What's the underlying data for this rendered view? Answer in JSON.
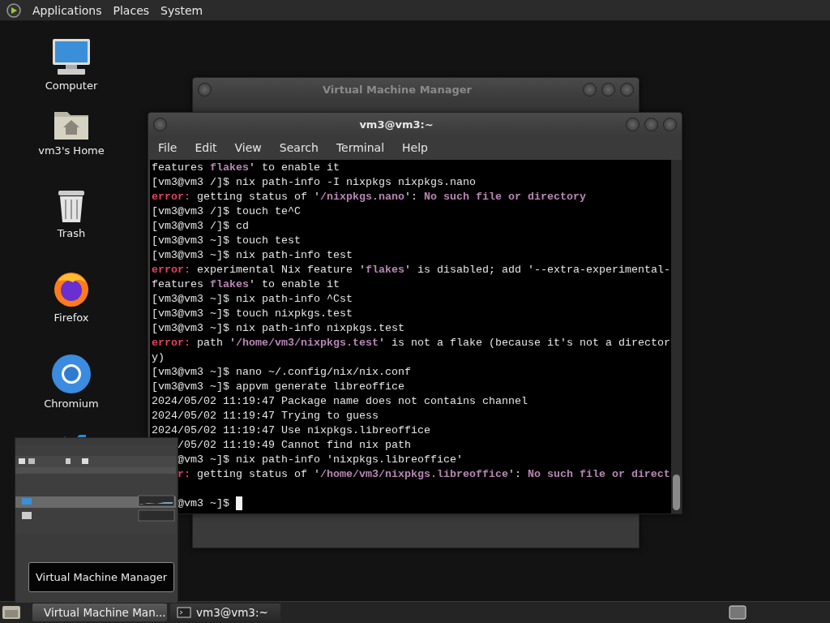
{
  "top_panel": {
    "menus": [
      {
        "label": "Applications"
      },
      {
        "label": "Places"
      },
      {
        "label": "System"
      }
    ]
  },
  "desktop_icons": [
    {
      "kind": "computer",
      "label": "Computer"
    },
    {
      "kind": "home",
      "label": "vm3's Home"
    },
    {
      "kind": "trash",
      "label": "Trash"
    },
    {
      "kind": "firefox",
      "label": "Firefox"
    },
    {
      "kind": "chromium",
      "label": "Chromium"
    },
    {
      "kind": "code"
    }
  ],
  "back_window": {
    "title": "Virtual Machine Manager"
  },
  "terminal": {
    "title": "vm3@vm3:~",
    "menus": [
      {
        "label": "File"
      },
      {
        "label": "Edit"
      },
      {
        "label": "View"
      },
      {
        "label": "Search"
      },
      {
        "label": "Terminal"
      },
      {
        "label": "Help"
      }
    ],
    "cursor": true,
    "lines": [
      {
        "covered": false,
        "segments": [
          {
            "kind": "plain",
            "text": "features "
          },
          {
            "kind": "path",
            "text": "flakes"
          },
          {
            "kind": "plain",
            "text": "' to enable it"
          }
        ]
      },
      {
        "covered": false,
        "segments": [
          {
            "kind": "plain",
            "text": "[vm3@vm3 /]$ nix path-info -I nixpkgs nixpkgs.nano"
          }
        ]
      },
      {
        "covered": false,
        "segments": [
          {
            "kind": "error",
            "text": "error:"
          },
          {
            "kind": "plain",
            "text": " getting status of '"
          },
          {
            "kind": "path",
            "text": "/nixpkgs.nano"
          },
          {
            "kind": "plain",
            "text": "': "
          },
          {
            "kind": "path",
            "text": "No such file or directory"
          }
        ]
      },
      {
        "covered": false,
        "segments": [
          {
            "kind": "plain",
            "text": "[vm3@vm3 /]$ touch te^C"
          }
        ]
      },
      {
        "covered": false,
        "segments": [
          {
            "kind": "plain",
            "text": "[vm3@vm3 /]$ cd"
          }
        ]
      },
      {
        "covered": false,
        "segments": [
          {
            "kind": "plain",
            "text": "[vm3@vm3 ~]$ touch test"
          }
        ]
      },
      {
        "covered": false,
        "segments": [
          {
            "kind": "plain",
            "text": "[vm3@vm3 ~]$ nix path-info test"
          }
        ]
      },
      {
        "covered": false,
        "segments": [
          {
            "kind": "error",
            "text": "error:"
          },
          {
            "kind": "plain",
            "text": " experimental Nix feature '"
          },
          {
            "kind": "path",
            "text": "flakes"
          },
          {
            "kind": "plain",
            "text": "' is disabled; add '--extra-experimental-"
          }
        ]
      },
      {
        "covered": false,
        "segments": [
          {
            "kind": "plain",
            "text": "features "
          },
          {
            "kind": "path",
            "text": "flakes"
          },
          {
            "kind": "plain",
            "text": "' to enable it"
          }
        ]
      },
      {
        "covered": false,
        "segments": [
          {
            "kind": "plain",
            "text": "[vm3@vm3 ~]$ nix path-info ^Cst"
          }
        ]
      },
      {
        "covered": false,
        "segments": [
          {
            "kind": "plain",
            "text": "[vm3@vm3 ~]$ touch nixpkgs.test"
          }
        ]
      },
      {
        "covered": false,
        "segments": [
          {
            "kind": "plain",
            "text": "[vm3@vm3 ~]$ nix path-info nixpkgs.test"
          }
        ]
      },
      {
        "covered": false,
        "segments": [
          {
            "kind": "error",
            "text": "error:"
          },
          {
            "kind": "plain",
            "text": " path '"
          },
          {
            "kind": "path",
            "text": "/home/vm3/nixpkgs.test"
          },
          {
            "kind": "plain",
            "text": "' is not a flake (because it's not a director"
          }
        ]
      },
      {
        "covered": false,
        "segments": [
          {
            "kind": "plain",
            "text": "y)"
          }
        ]
      },
      {
        "covered": false,
        "segments": [
          {
            "kind": "plain",
            "text": "[vm3@vm3 ~]$ nano ~/.config/nix/nix.conf"
          }
        ]
      },
      {
        "covered": false,
        "segments": [
          {
            "kind": "plain",
            "text": "[vm3@vm3 ~]$ appvm generate libreoffice"
          }
        ]
      },
      {
        "covered": false,
        "segments": [
          {
            "kind": "plain",
            "text": "2024/05/02 11:19:47 Package name does not contains channel"
          }
        ]
      },
      {
        "covered": false,
        "segments": [
          {
            "kind": "plain",
            "text": "2024/05/02 11:19:47 Trying to guess"
          }
        ]
      },
      {
        "covered": false,
        "segments": [
          {
            "kind": "plain",
            "text": "2024/05/02 11:19:47 Use nixpkgs.libreoffice"
          }
        ]
      },
      {
        "covered": true,
        "segments": [
          {
            "kind": "plain",
            "text": "/05/02 11:19:49 Cannot find nix path"
          }
        ]
      },
      {
        "covered": true,
        "segments": [
          {
            "kind": "plain",
            "text": "@vm3 ~]$ nix path-info 'nixpkgs.libreoffice'"
          }
        ]
      },
      {
        "covered": true,
        "segments": [
          {
            "kind": "error",
            "text": "r:"
          },
          {
            "kind": "plain",
            "text": " getting status of '"
          },
          {
            "kind": "path",
            "text": "/home/vm3/nixpkgs.libreoffice"
          },
          {
            "kind": "plain",
            "text": "': "
          },
          {
            "kind": "path",
            "text": "No such file or direct"
          }
        ]
      },
      {
        "covered": false
      },
      {
        "covered": true,
        "segments": [
          {
            "kind": "plain",
            "text": "@vm3 ~]$ "
          }
        ]
      }
    ]
  },
  "preview": {
    "tooltip": "Virtual Machine Manager"
  },
  "taskbar": {
    "tasks": [
      {
        "kind": "vmm",
        "label": "Virtual Machine Man...",
        "selected": true
      },
      {
        "kind": "terminal",
        "label": "vm3@vm3:~",
        "selected": false
      }
    ]
  }
}
